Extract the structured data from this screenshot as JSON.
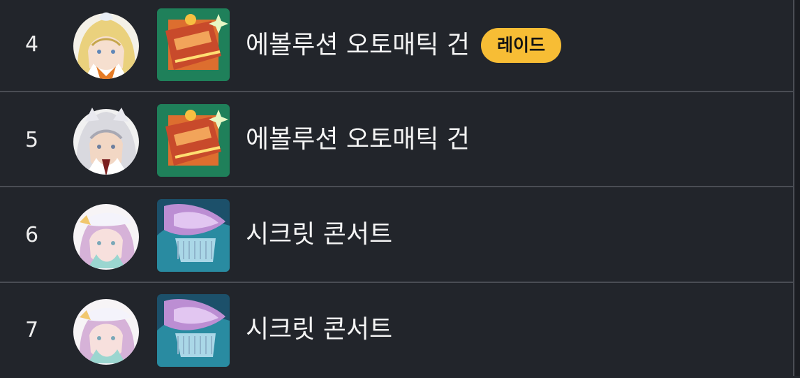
{
  "rows": [
    {
      "rank": "4",
      "avatar": "blonde-hair-character-avatar",
      "skill_icon": "evolution-automatic-gun-icon",
      "skill_name": "에볼루션 오토매틱 건",
      "badge": "레이드"
    },
    {
      "rank": "5",
      "avatar": "silver-hair-character-avatar",
      "skill_icon": "evolution-automatic-gun-icon",
      "skill_name": "에볼루션 오토매틱 건"
    },
    {
      "rank": "6",
      "avatar": "white-hat-character-avatar",
      "skill_icon": "secret-concert-icon",
      "skill_name": "시크릿 콘서트"
    },
    {
      "rank": "7",
      "avatar": "white-hat-character-avatar",
      "skill_icon": "secret-concert-icon",
      "skill_name": "시크릿 콘서트"
    }
  ],
  "colors": {
    "background": "#22252b",
    "divider": "#4a4d54",
    "badge": "#f7bd35",
    "text": "#f4f4f4"
  }
}
